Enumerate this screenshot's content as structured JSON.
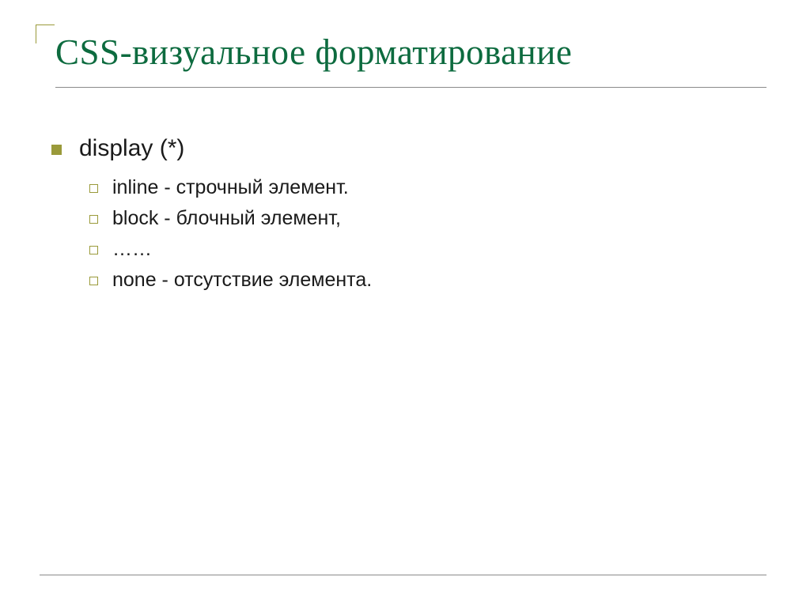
{
  "slide": {
    "title": "CSS-визуальное форматирование",
    "level1": {
      "text": "display (*)"
    },
    "level2_items": [
      {
        "text": "inline - строчный элемент."
      },
      {
        "text": "block - блочный элемент,"
      },
      {
        "text": "……"
      },
      {
        "text": "none - отсутствие элемента."
      }
    ]
  }
}
